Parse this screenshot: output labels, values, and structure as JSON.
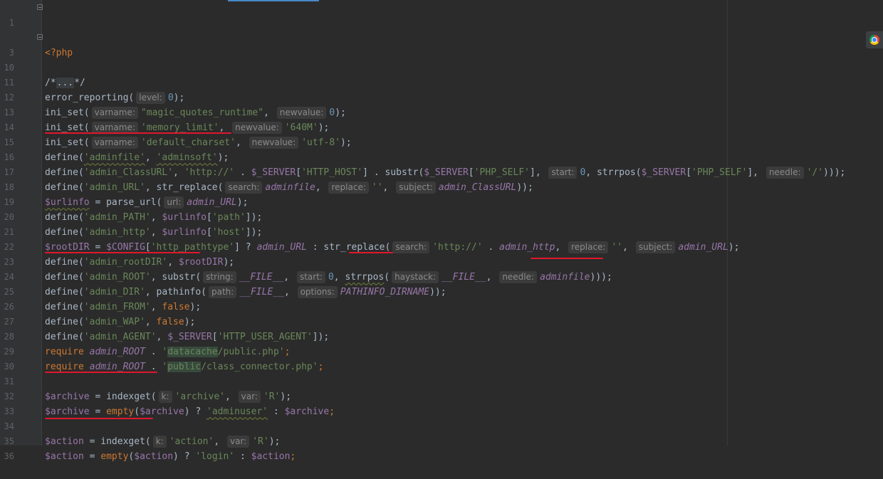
{
  "editor": {
    "lines": {
      "l1": {
        "num": "1",
        "t1": "<?php"
      },
      "l3": {
        "num": "3",
        "t1": "/*",
        "t2": "...",
        "t3": "*/"
      },
      "l10": {
        "num": "10"
      },
      "l11": {
        "num": "11",
        "t1": "error_reporting(",
        "h1": "level:",
        "t2": "0",
        "t3": ");"
      },
      "l12": {
        "num": "12",
        "t1": "ini_set(",
        "h1": "varname:",
        "t2": "\"magic_quotes_runtime\"",
        "t3": ", ",
        "h2": "newvalue:",
        "t4": "0",
        "t5": ");"
      },
      "l13": {
        "num": "13",
        "t1": "ini_set(",
        "h1": "varname:",
        "t2": "'memory_limit'",
        "t3": ", ",
        "h2": "newvalue:",
        "t4": "'640M'",
        "t5": ");"
      },
      "l14": {
        "num": "14",
        "t1": "ini_set(",
        "h1": "varname:",
        "t2": "'default_charset'",
        "t3": ", ",
        "h2": "newvalue:",
        "t4": "'utf-8'",
        "t5": ");"
      },
      "l15": {
        "num": "15",
        "t1": "define(",
        "t2": "'adminfile'",
        "t3": ", ",
        "t4": "'adminsoft'",
        "t5": ");"
      },
      "l16": {
        "num": "16",
        "t1": "define(",
        "t2": "'admin_ClassURL'",
        "t3": ", ",
        "t4": "'http://'",
        "t5": " . ",
        "t6": "$_SERVER",
        "t7": "[",
        "t8": "'HTTP_HOST'",
        "t9": "] . substr(",
        "t10": "$_SERVER",
        "t11": "[",
        "t12": "'PHP_SELF'",
        "t13": "], ",
        "h1": "start:",
        "t14": "0",
        "t15": ", strrpos(",
        "t16": "$_SERVER",
        "t17": "[",
        "t18": "'PHP_SELF'",
        "t19": "], ",
        "h2": "needle:",
        "t20": "'/'",
        "t21": ")));"
      },
      "l17": {
        "num": "17",
        "t1": "define(",
        "t2": "'admin_URL'",
        "t3": ", str_replace(",
        "h1": "search:",
        "t4": "adminfile",
        "t5": ", ",
        "h2": "replace:",
        "t6": "''",
        "t7": ", ",
        "h3": "subject:",
        "t8": "admin_ClassURL",
        "t9": "));"
      },
      "l18": {
        "num": "18",
        "t1": "$urlinfo",
        "t2": " = parse_url(",
        "h1": "url:",
        "t3": "admin_URL",
        "t4": ");"
      },
      "l19": {
        "num": "19",
        "t1": "define(",
        "t2": "'admin_PATH'",
        "t3": ", ",
        "t4": "$urlinfo",
        "t5": "[",
        "t6": "'path'",
        "t7": "]);"
      },
      "l20": {
        "num": "20",
        "t1": "define(",
        "t2": "'admin_http'",
        "t3": ", ",
        "t4": "$urlinfo",
        "t5": "[",
        "t6": "'host'",
        "t7": "]);"
      },
      "l21": {
        "num": "21",
        "t1": "$rootDIR",
        "t2": " = ",
        "t3": "$CONFIG",
        "t4": "[",
        "t5": "'http_pathtype'",
        "t6": "] ? ",
        "t7": "admin_URL",
        "t8": " : str_replace(",
        "h1": "search:",
        "t9": "'http://'",
        "t10": " . ",
        "t11": "admin_http",
        "t12": ", ",
        "h2": "replace:",
        "t13": "''",
        "t14": ", ",
        "h3": "subject:",
        "t15": "admin_URL",
        "t16": ");"
      },
      "l22": {
        "num": "22",
        "t1": "define(",
        "t2": "'admin_rootDIR'",
        "t3": ", ",
        "t4": "$rootDIR",
        "t5": ");"
      },
      "l23": {
        "num": "23",
        "t1": "define(",
        "t2": "'admin_ROOT'",
        "t3": ", substr(",
        "h1": "string:",
        "t4": "__FILE__",
        "t5": ", ",
        "h2": "start:",
        "t6": "0",
        "t7": ", ",
        "t8": "strrpos",
        "t9": "(",
        "h3": "haystack:",
        "t10": "__FILE__",
        "t11": ", ",
        "h4": "needle:",
        "t12": "adminfile",
        "t13": ")));"
      },
      "l24": {
        "num": "24",
        "t1": "define(",
        "t2": "'admin_DIR'",
        "t3": ", pathinfo(",
        "h1": "path:",
        "t4": "__FILE__",
        "t5": ", ",
        "h2": "options:",
        "t6": "PATHINFO_DIRNAME",
        "t7": "));"
      },
      "l25": {
        "num": "25",
        "t1": "define(",
        "t2": "'admin_FROM'",
        "t3": ", ",
        "t4": "false",
        "t5": ");"
      },
      "l26": {
        "num": "26",
        "t1": "define(",
        "t2": "'admin_WAP'",
        "t3": ", ",
        "t4": "false",
        "t5": ");"
      },
      "l27": {
        "num": "27",
        "t1": "define(",
        "t2": "'admin_AGENT'",
        "t3": ", ",
        "t4": "$_SERVER",
        "t5": "[",
        "t6": "'HTTP_USER_AGENT'",
        "t7": "]);"
      },
      "l28": {
        "num": "28",
        "t1": "require ",
        "t2": "admin_ROOT",
        "t3": " . ",
        "t4": "'",
        "t5": "datacache",
        "t6": "/public.php'",
        "t7": ";"
      },
      "l29": {
        "num": "29",
        "t1": "require ",
        "t2": "admin_ROOT",
        "t3": " . ",
        "t4": "'",
        "t5": "public",
        "t6": "/class_connector.php'",
        "t7": ";"
      },
      "l30": {
        "num": "30"
      },
      "l31": {
        "num": "31",
        "t1": "$archive",
        "t2": " = indexget(",
        "h1": "k:",
        "t3": "'archive'",
        "t4": ", ",
        "h2": "var:",
        "t5": "'R'",
        "t6": ");"
      },
      "l32": {
        "num": "32",
        "t1": "$archive",
        "t2": " = ",
        "t3": "empty",
        "t4": "(",
        "t5": "$archive",
        "t6": ") ? ",
        "t7": "'adminuser'",
        "t8": " : ",
        "t9": "$archive",
        "t10": ";"
      },
      "l33": {
        "num": "33"
      },
      "l34": {
        "num": "34",
        "t1": "$action",
        "t2": " = indexget(",
        "h1": "k:",
        "t3": "'action'",
        "t4": ", ",
        "h2": "var:",
        "t5": "'R'",
        "t6": ");"
      },
      "l35": {
        "num": "35",
        "t1": "$action",
        "t2": " = ",
        "t3": "empty",
        "t4": "(",
        "t5": "$action",
        "t6": ") ? ",
        "t7": "'login'",
        "t8": " : ",
        "t9": "$action",
        "t10": ";"
      },
      "l36": {
        "num": "36"
      }
    },
    "colors": {
      "background": "#2b2b2b",
      "keyword": "#cc7832",
      "string": "#6a8759",
      "number": "#6897bb",
      "variable": "#9876aa",
      "annotation_underline": "#e0172c"
    }
  },
  "icons": {
    "browser": "chrome-icon"
  }
}
